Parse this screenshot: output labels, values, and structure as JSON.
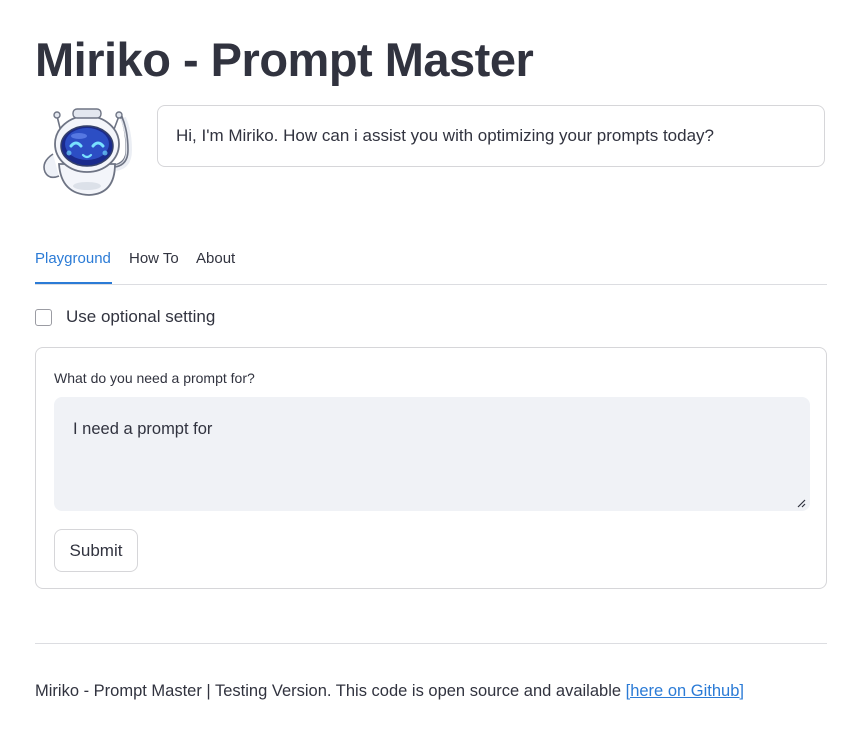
{
  "header": {
    "title": "Miriko - Prompt Master"
  },
  "assistant": {
    "avatar_icon": "robot-icon",
    "greeting": "Hi, I'm Miriko. How can i assist you with optimizing your prompts today?"
  },
  "tabs": [
    {
      "label": "Playground",
      "active": true
    },
    {
      "label": "How To",
      "active": false
    },
    {
      "label": "About",
      "active": false
    }
  ],
  "options": {
    "optional_setting_label": "Use optional setting",
    "optional_setting_checked": false
  },
  "form": {
    "label": "What do you need a prompt for?",
    "textarea_value": "I need a prompt for",
    "submit_label": "Submit"
  },
  "footer": {
    "text": "Miriko - Prompt Master | Testing Version. This code is open source and available ",
    "link_text": "[here on Github]"
  },
  "colors": {
    "accent": "#2b7bd6",
    "text": "#31333f",
    "input_bg": "#f0f2f6",
    "border": "#d6d6d9"
  }
}
